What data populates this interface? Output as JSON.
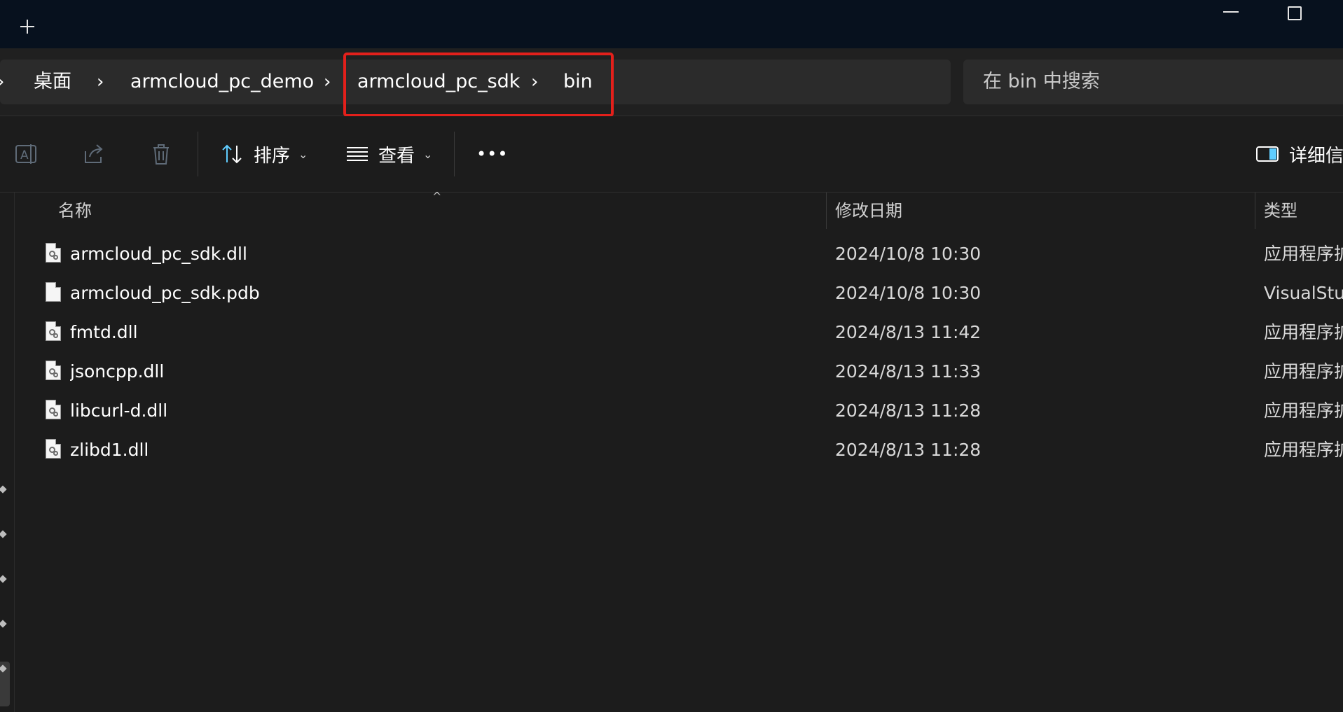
{
  "titlebar": {
    "new_tab_icon": "plus-icon",
    "minimize_icon": "minimize-icon",
    "maximize_icon": "maximize-icon"
  },
  "breadcrumb": {
    "items": [
      "桌面",
      "armcloud_pc_demo",
      "armcloud_pc_sdk",
      "bin"
    ],
    "separator": "›"
  },
  "search": {
    "placeholder": "在 bin 中搜索"
  },
  "toolbar": {
    "sort_label": "排序",
    "view_label": "查看",
    "more_label": "•••",
    "details_label": "详细信息",
    "caret": "⌄"
  },
  "columns": {
    "name": "名称",
    "modified": "修改日期",
    "type": "类型",
    "sort_indicator": "^"
  },
  "files": [
    {
      "name": "armcloud_pc_sdk.dll",
      "modified": "2024/10/8 10:30",
      "type": "应用程序扩展",
      "icon": "dll-file-icon"
    },
    {
      "name": "armcloud_pc_sdk.pdb",
      "modified": "2024/10/8 10:30",
      "type": "VisualStudio",
      "icon": "generic-file-icon"
    },
    {
      "name": "fmtd.dll",
      "modified": "2024/8/13 11:42",
      "type": "应用程序扩展",
      "icon": "dll-file-icon"
    },
    {
      "name": "jsoncpp.dll",
      "modified": "2024/8/13 11:33",
      "type": "应用程序扩展",
      "icon": "dll-file-icon"
    },
    {
      "name": "libcurl-d.dll",
      "modified": "2024/8/13 11:28",
      "type": "应用程序扩展",
      "icon": "dll-file-icon"
    },
    {
      "name": "zlibd1.dll",
      "modified": "2024/8/13 11:28",
      "type": "应用程序扩展",
      "icon": "dll-file-icon"
    }
  ],
  "colors": {
    "highlight": "#e3201b",
    "accent": "#60cdff",
    "background": "#1c1c1c",
    "titlebar": "#07111e"
  }
}
